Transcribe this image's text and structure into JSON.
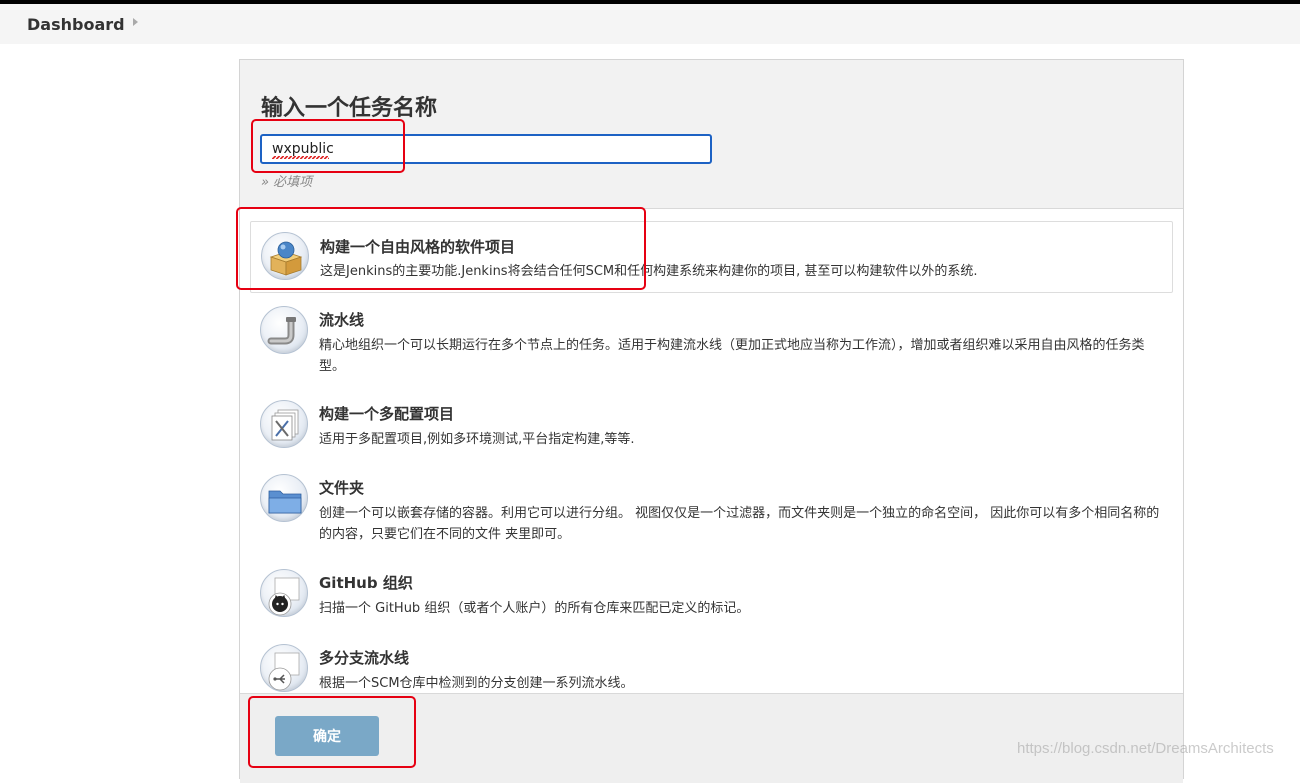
{
  "breadcrumb": {
    "label": "Dashboard"
  },
  "form": {
    "title": "输入一个任务名称",
    "name_value": "wxpublic",
    "required_hint": "» 必填项"
  },
  "items": [
    {
      "title": "构建一个自由风格的软件项目",
      "description": "这是Jenkins的主要功能.Jenkins将会结合任何SCM和任何构建系统来构建你的项目, 甚至可以构建软件以外的系统.",
      "icon": "freestyle-box-icon"
    },
    {
      "title": "流水线",
      "description": "精心地组织一个可以长期运行在多个节点上的任务。适用于构建流水线（更加正式地应当称为工作流），增加或者组织难以采用自由风格的任务类型。",
      "icon": "pipeline-icon"
    },
    {
      "title": "构建一个多配置项目",
      "description": "适用于多配置项目,例如多环境测试,平台指定构建,等等.",
      "icon": "multi-config-icon"
    },
    {
      "title": "文件夹",
      "description": "创建一个可以嵌套存储的容器。利用它可以进行分组。 视图仅仅是一个过滤器，而文件夹则是一个独立的命名空间， 因此你可以有多个相同名称的的内容，只要它们在不同的文件 夹里即可。",
      "icon": "folder-icon"
    },
    {
      "title": "GitHub 组织",
      "description": "扫描一个 GitHub 组织（或者个人账户）的所有仓库来匹配已定义的标记。",
      "icon": "github-icon"
    },
    {
      "title": "多分支流水线",
      "description": "根据一个SCM仓库中检测到的分支创建一系列流水线。",
      "icon": "multibranch-icon"
    }
  ],
  "footer": {
    "ok_label": "确定"
  },
  "watermark": "https://blog.csdn.net/DreamsArchitects",
  "colors": {
    "accent": "#1d62c4",
    "ok_button": "#7aa8c7",
    "highlight": "#e60012"
  }
}
